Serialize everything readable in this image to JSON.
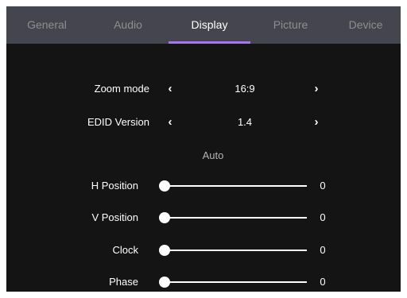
{
  "tabs": [
    {
      "label": "General",
      "active": false
    },
    {
      "label": "Audio",
      "active": false
    },
    {
      "label": "Display",
      "active": true
    },
    {
      "label": "Picture",
      "active": false
    },
    {
      "label": "Device",
      "active": false
    }
  ],
  "colors": {
    "tabbar_bg": "#45454f",
    "active_underline": "#a675f0",
    "background": "#141414"
  },
  "zoom_mode": {
    "label": "Zoom mode",
    "value": "16:9"
  },
  "edid_version": {
    "label": "EDID Version",
    "value": "1.4"
  },
  "auto_section": {
    "label": "Auto"
  },
  "sliders": [
    {
      "label": "H Position",
      "value": "0"
    },
    {
      "label": "V Position",
      "value": "0"
    },
    {
      "label": "Clock",
      "value": "0"
    },
    {
      "label": "Phase",
      "value": "0"
    }
  ],
  "icons": {
    "prev": "chevron-left-icon",
    "next": "chevron-right-icon"
  }
}
